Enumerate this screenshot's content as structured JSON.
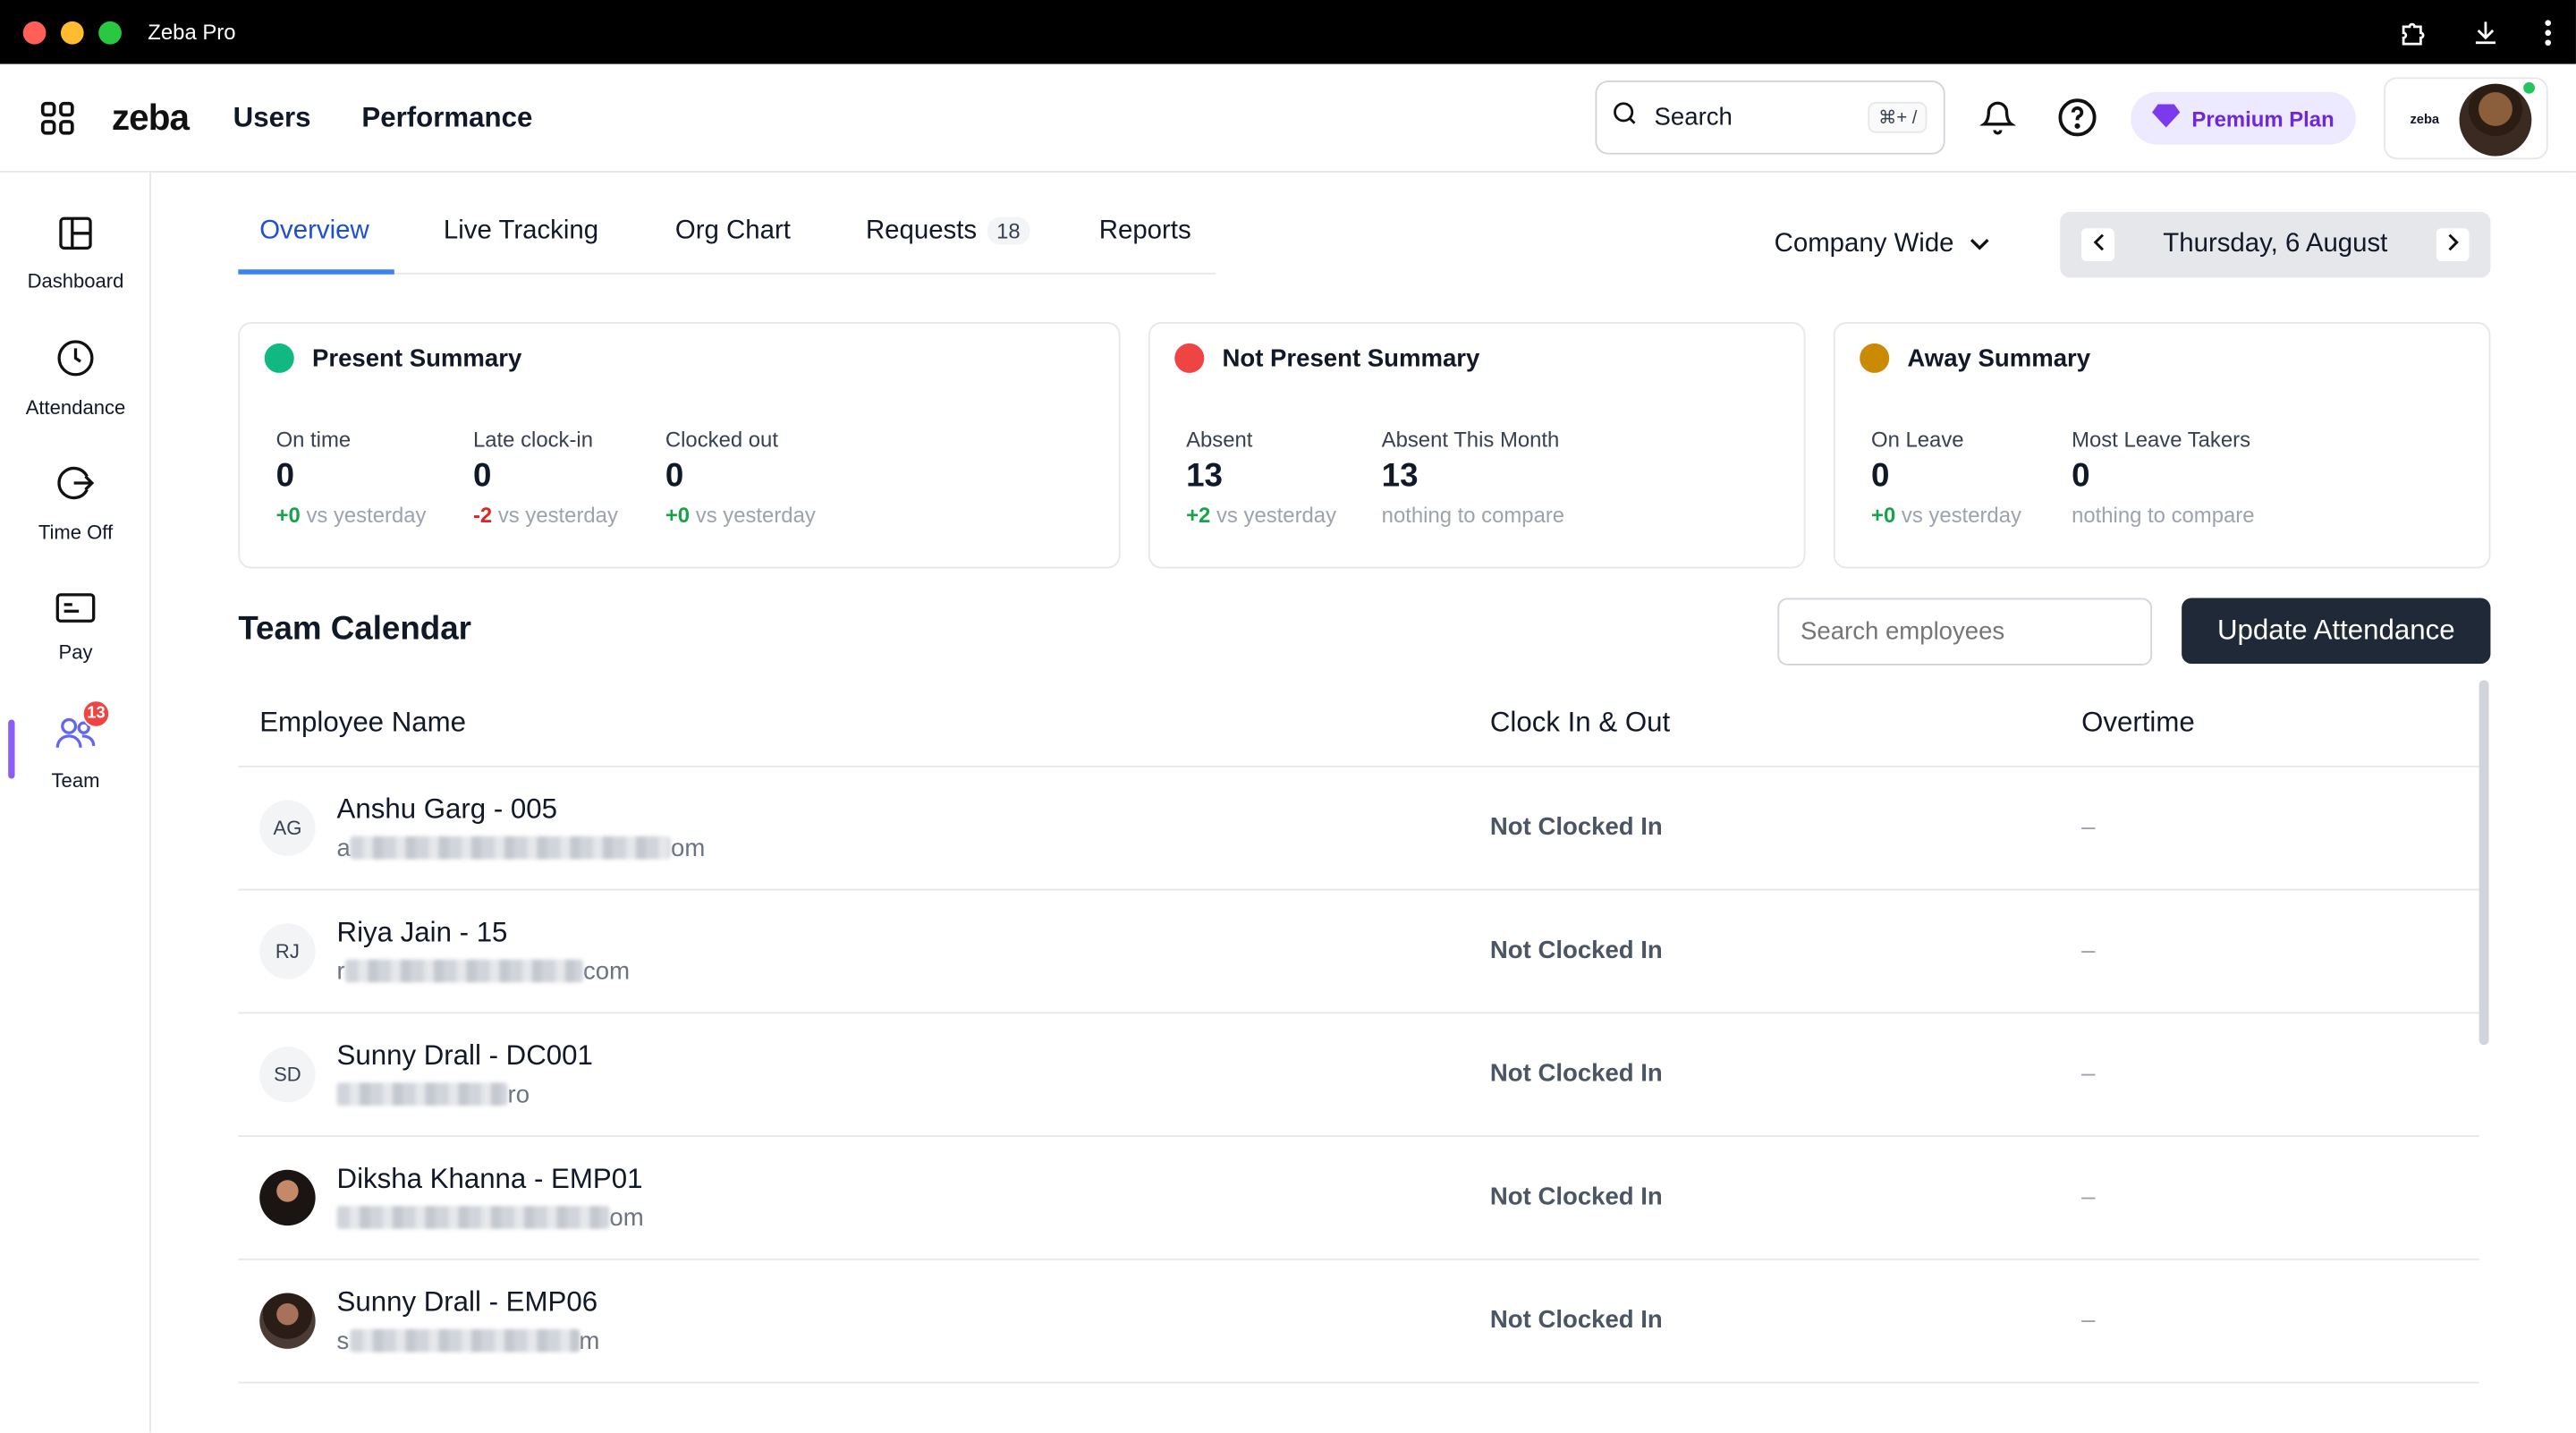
{
  "window": {
    "title": "Zeba Pro"
  },
  "header": {
    "logo": "zeba",
    "nav": [
      "Users",
      "Performance"
    ],
    "search_label": "Search",
    "search_shortcut": "⌘+ /",
    "premium_label": "Premium Plan",
    "profile_logo": "zeba"
  },
  "sidebar": {
    "items": [
      {
        "label": "Dashboard",
        "icon": "dashboard-icon"
      },
      {
        "label": "Attendance",
        "icon": "clock-icon"
      },
      {
        "label": "Time Off",
        "icon": "logout-icon"
      },
      {
        "label": "Pay",
        "icon": "card-icon"
      },
      {
        "label": "Team",
        "icon": "team-icon",
        "badge": "13",
        "active": true
      }
    ]
  },
  "tabs": {
    "items": [
      "Overview",
      "Live Tracking",
      "Org Chart",
      "Requests",
      "Reports"
    ],
    "requests_count": "18",
    "active": "Overview"
  },
  "filters": {
    "scope": "Company Wide",
    "date": "Thursday, 6 August"
  },
  "summary": {
    "present": {
      "title": "Present Summary",
      "color": "#16a34a",
      "metrics": [
        {
          "label": "On time",
          "value": "0",
          "delta": "+0",
          "delta_text": "vs yesterday"
        },
        {
          "label": "Late clock-in",
          "value": "0",
          "delta": "-2",
          "delta_text": "vs yesterday"
        },
        {
          "label": "Clocked out",
          "value": "0",
          "delta": "+0",
          "delta_text": "vs yesterday"
        }
      ]
    },
    "not_present": {
      "title": "Not Present Summary",
      "color": "#ef4444",
      "metrics": [
        {
          "label": "Absent",
          "value": "13",
          "delta": "+2",
          "delta_text": "vs yesterday"
        },
        {
          "label": "Absent This Month",
          "value": "13",
          "delta": "",
          "delta_text": "nothing to compare"
        }
      ]
    },
    "away": {
      "title": "Away Summary",
      "color": "#ca8a04",
      "metrics": [
        {
          "label": "On Leave",
          "value": "0",
          "delta": "+0",
          "delta_text": "vs yesterday"
        },
        {
          "label": "Most Leave Takers",
          "value": "0",
          "delta": "",
          "delta_text": "nothing to compare"
        }
      ]
    }
  },
  "team_calendar": {
    "title": "Team Calendar",
    "search_placeholder": "Search employees",
    "update_button": "Update Attendance",
    "columns": [
      "Employee Name",
      "Clock In & Out",
      "Overtime"
    ],
    "rows": [
      {
        "initials": "AG",
        "name": "Anshu Garg - 005",
        "email_prefix": "a",
        "email_suffix": "om",
        "clock": "Not Clocked In",
        "overtime": "–"
      },
      {
        "initials": "RJ",
        "name": "Riya Jain - 15",
        "email_prefix": "r",
        "email_suffix": "com",
        "clock": "Not Clocked In",
        "overtime": "–"
      },
      {
        "initials": "SD",
        "name": "Sunny Drall - DC001",
        "email_prefix": "",
        "email_suffix": "ro",
        "clock": "Not Clocked In",
        "overtime": "–"
      },
      {
        "initials": "",
        "name": "Diksha Khanna - EMP01",
        "email_prefix": "",
        "email_suffix": "om",
        "clock": "Not Clocked In",
        "overtime": "–"
      },
      {
        "initials": "",
        "name": "Sunny Drall - EMP06",
        "email_prefix": "s",
        "email_suffix": "m",
        "clock": "Not Clocked In",
        "overtime": "–"
      }
    ]
  }
}
